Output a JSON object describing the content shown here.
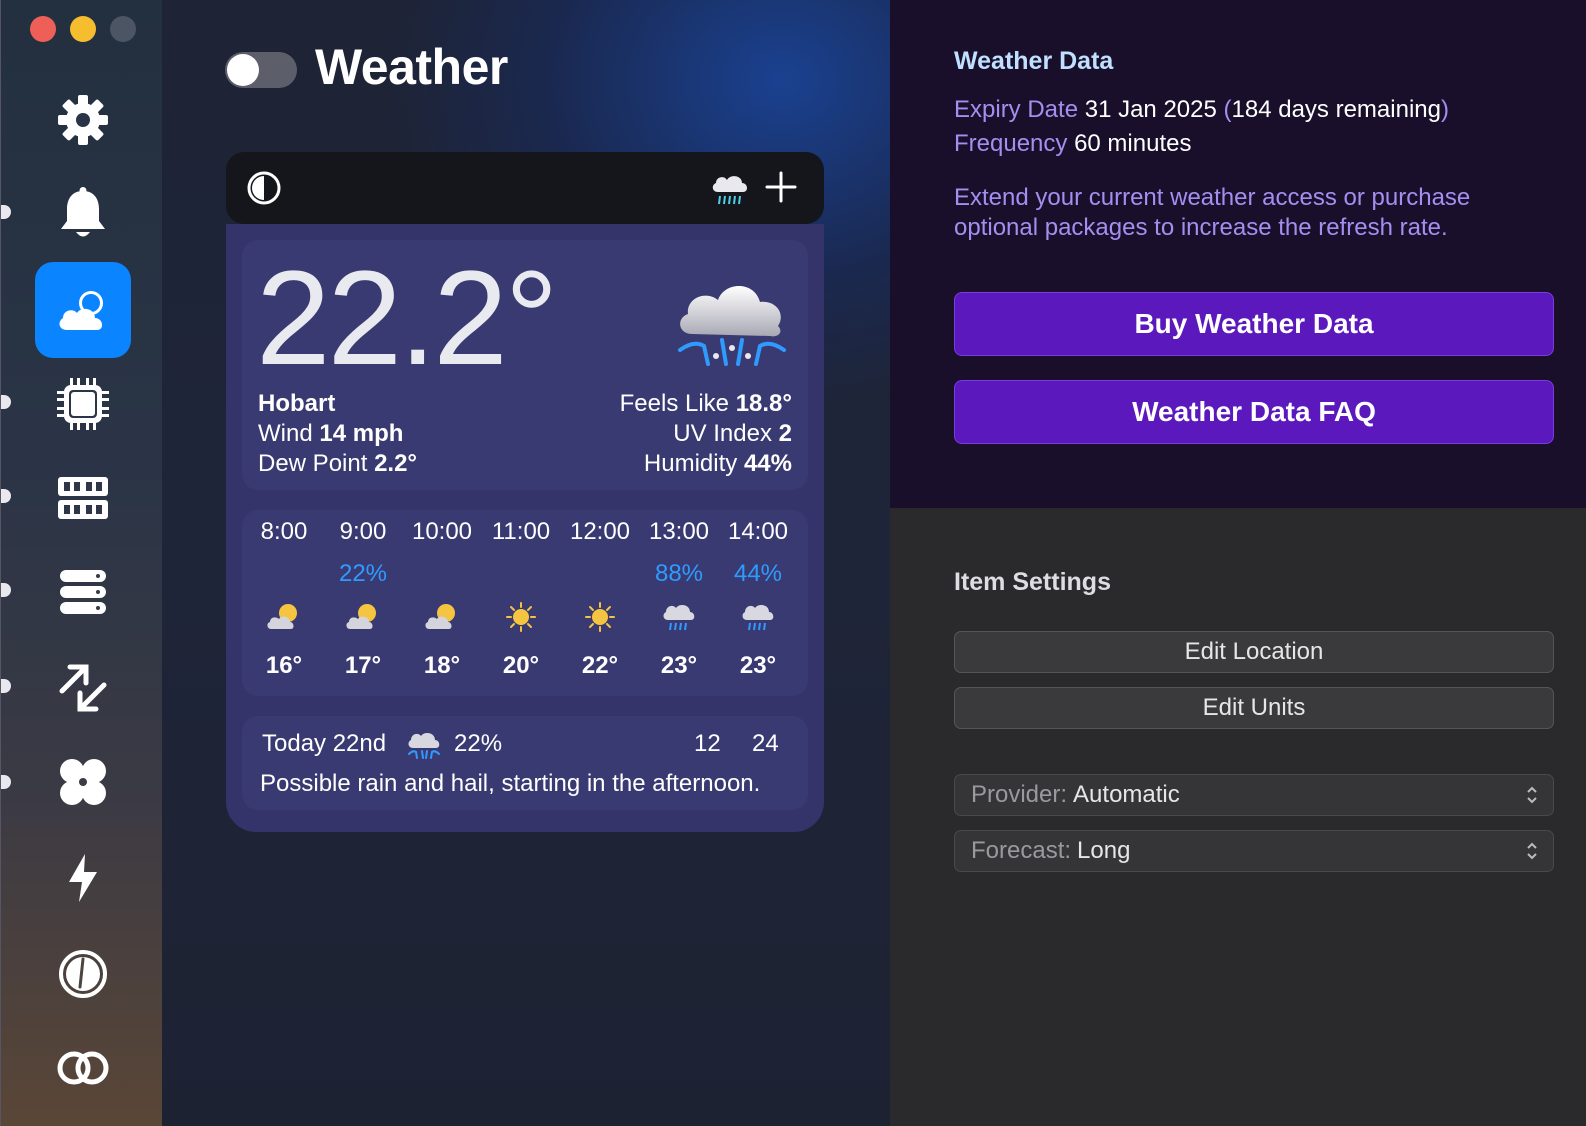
{
  "window": {
    "title": "Weather",
    "toggle_on": false
  },
  "sidebar": {
    "items": [
      {
        "icon": "gear-icon",
        "active": false
      },
      {
        "icon": "bell-icon",
        "active": false
      },
      {
        "icon": "weather-cloud-icon",
        "active": true
      },
      {
        "icon": "cpu-chip-icon",
        "active": false
      },
      {
        "icon": "memory-icon",
        "active": false
      },
      {
        "icon": "disk-stack-icon",
        "active": false
      },
      {
        "icon": "network-arrows-icon",
        "active": false
      },
      {
        "icon": "fan-icon",
        "active": false
      },
      {
        "icon": "power-bolt-icon",
        "active": false
      },
      {
        "icon": "gauge-clock-icon",
        "active": false
      },
      {
        "icon": "combined-rings-icon",
        "active": false
      }
    ]
  },
  "widget": {
    "current": {
      "temperature": "22.2°",
      "location": "Hobart",
      "wind_label": "Wind",
      "wind_value": "14 mph",
      "dew_label": "Dew Point",
      "dew_value": "2.2°",
      "feels_label": "Feels Like",
      "feels_value": "18.8°",
      "uv_label": "UV Index",
      "uv_value": "2",
      "humidity_label": "Humidity",
      "humidity_value": "44%",
      "condition_icon": "thunderstorm-hail-icon"
    },
    "hourly": [
      {
        "time": "8:00",
        "precip": "",
        "icon": "partly-sunny-icon",
        "temp": "16°"
      },
      {
        "time": "9:00",
        "precip": "22%",
        "icon": "partly-sunny-icon",
        "temp": "17°"
      },
      {
        "time": "10:00",
        "precip": "",
        "icon": "partly-sunny-icon",
        "temp": "18°"
      },
      {
        "time": "11:00",
        "precip": "",
        "icon": "sun-icon",
        "temp": "20°"
      },
      {
        "time": "12:00",
        "precip": "",
        "icon": "sun-icon",
        "temp": "22°"
      },
      {
        "time": "13:00",
        "precip": "88%",
        "icon": "rain-cloud-icon",
        "temp": "23°"
      },
      {
        "time": "14:00",
        "precip": "44%",
        "icon": "rain-cloud-icon",
        "temp": "23°"
      }
    ],
    "daily": {
      "day": "Today 22nd",
      "precip": "22%",
      "low": "12",
      "high": "24",
      "summary": "Possible rain and hail, starting in the afternoon."
    }
  },
  "weather_data": {
    "heading": "Weather Data",
    "expiry_label": "Expiry Date",
    "expiry_value": "31 Jan 2025",
    "remaining_open": "(",
    "remaining_value": "184 days remaining",
    "remaining_close": ")",
    "frequency_label": "Frequency",
    "frequency_value": "60 minutes",
    "info_line1": "Extend your current weather access or purchase",
    "info_line2": "optional packages to increase the refresh rate.",
    "buy_button": "Buy Weather Data",
    "faq_button": "Weather Data FAQ"
  },
  "item_settings": {
    "heading": "Item Settings",
    "edit_location": "Edit Location",
    "edit_units": "Edit Units",
    "provider_label": "Provider:",
    "provider_value": "Automatic",
    "forecast_label": "Forecast:",
    "forecast_value": "Long"
  },
  "colors": {
    "accent": "#0a84ff",
    "purple_button": "#5b18bd",
    "precip_blue": "#2f9bff",
    "label_lavender": "#a48ef0"
  }
}
